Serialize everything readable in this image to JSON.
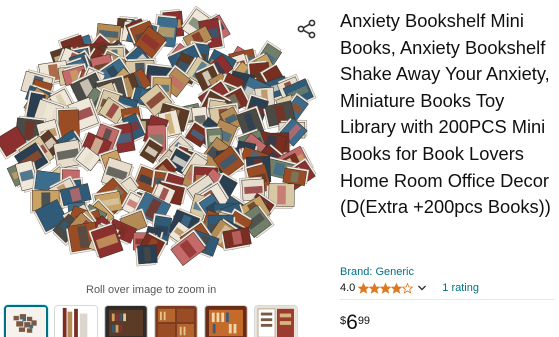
{
  "product": {
    "title": "Anxiety Bookshelf Mini Books, Anxiety Bookshelf Shake Away Your Anxiety, Miniature Books Toy Library with 200PCS Mini Books for Book Lovers Home Room Office Decor (D(Extra +200pcs Books))",
    "brand": "Brand: Generic",
    "rating_value": "4.0",
    "rating_stars": 4,
    "rating_count": "1 rating",
    "price_symbol": "$",
    "price_whole": "6",
    "price_fraction": "99"
  },
  "gallery": {
    "zoom_hint": "Roll over image to zoom in",
    "thumbnails": [
      {
        "name": "thumbnail-1",
        "selected": true
      },
      {
        "name": "thumbnail-2",
        "selected": false
      },
      {
        "name": "thumbnail-3",
        "selected": false
      },
      {
        "name": "thumbnail-4",
        "selected": false
      },
      {
        "name": "thumbnail-5",
        "selected": false
      },
      {
        "name": "thumbnail-6",
        "selected": false
      }
    ]
  },
  "icons": {
    "share": "share-icon",
    "star": "star-icon",
    "chevron": "chevron-down-icon"
  },
  "colors": {
    "link": "#007185",
    "star": "#de7921",
    "text": "#0f1111",
    "muted": "#565959"
  }
}
